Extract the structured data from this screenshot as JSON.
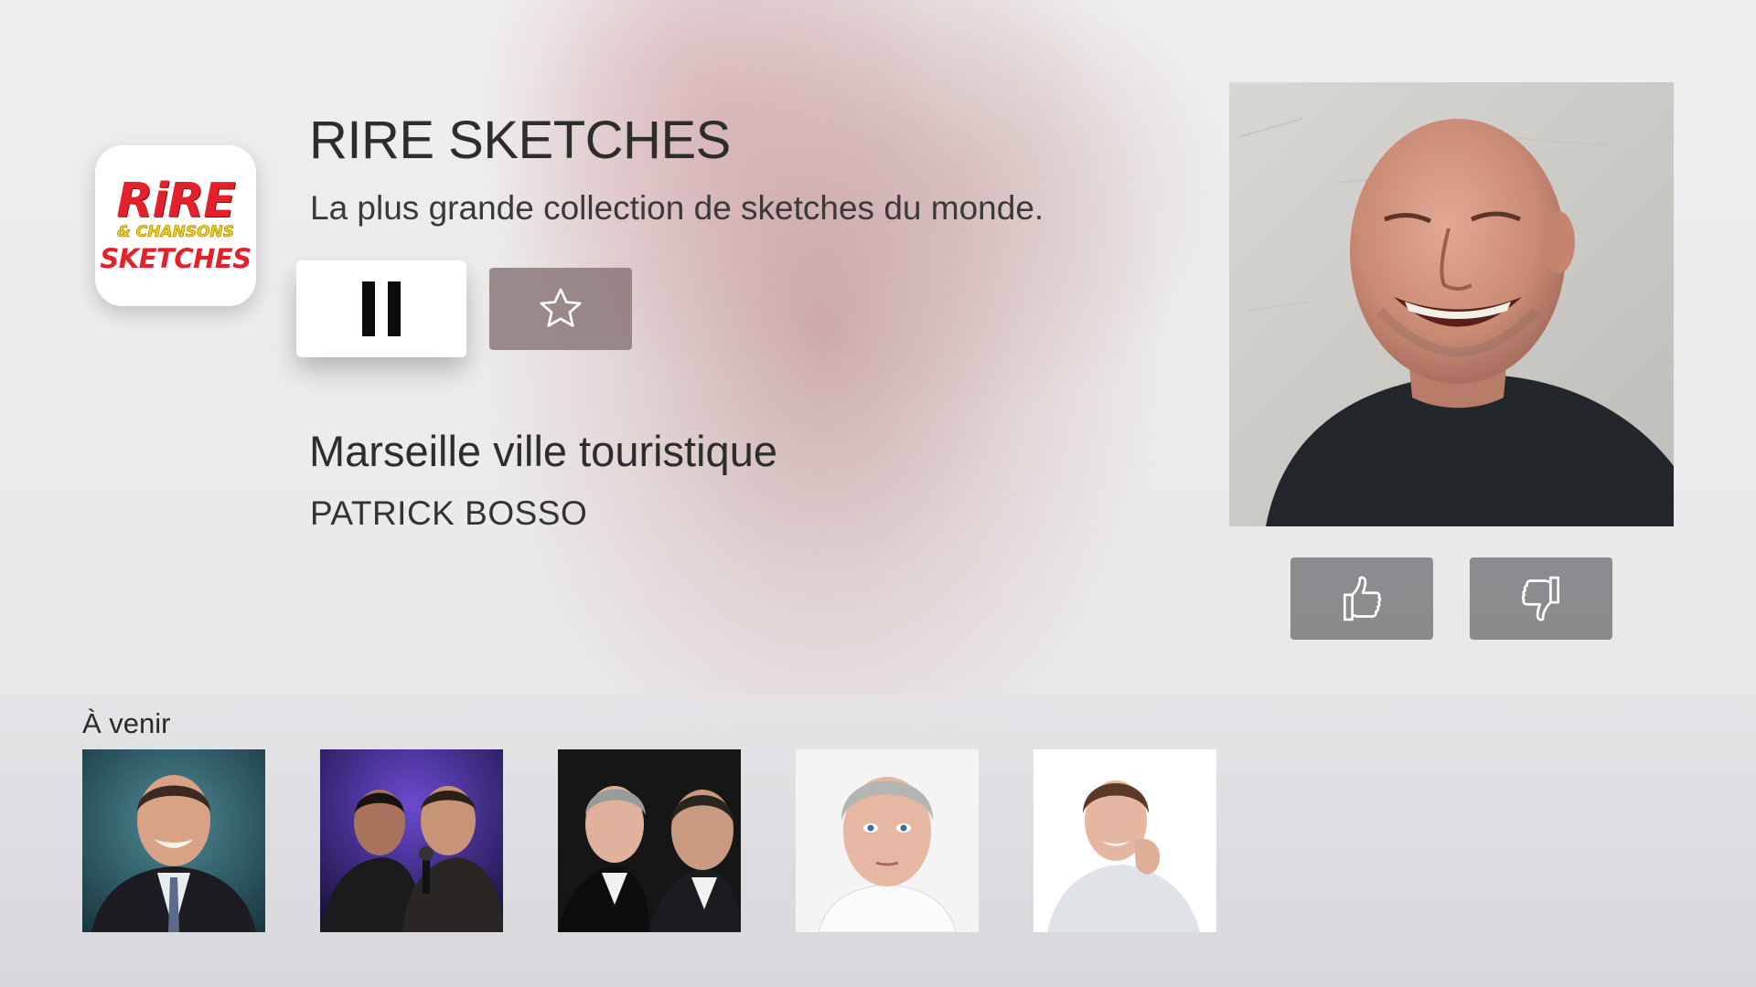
{
  "app": {
    "logo": {
      "line1": "RiRE",
      "line2": "& CHANSONS",
      "line3": "SKETCHES"
    }
  },
  "station": {
    "title": "RIRE SKETCHES",
    "subtitle": "La plus grande collection de sketches du monde."
  },
  "controls": {
    "pause_icon": "pause-icon",
    "favorite_icon": "star-outline-icon",
    "like_icon": "thumbs-up-icon",
    "dislike_icon": "thumbs-down-icon"
  },
  "now_playing": {
    "track": "Marseille ville touristique",
    "artist": "PATRICK BOSSO"
  },
  "upcoming": {
    "label": "À venir",
    "items": [
      {
        "image": "comedian-portrait-1"
      },
      {
        "image": "comedian-duo-stage"
      },
      {
        "image": "comedian-duo-portrait"
      },
      {
        "image": "comedian-portrait-2"
      },
      {
        "image": "comedian-portrait-3"
      }
    ]
  },
  "colors": {
    "logo_red": "#e4202b",
    "logo_yellow": "#f5d10e",
    "button_gray": "#76767a",
    "favorite_button": "#8c787a"
  }
}
